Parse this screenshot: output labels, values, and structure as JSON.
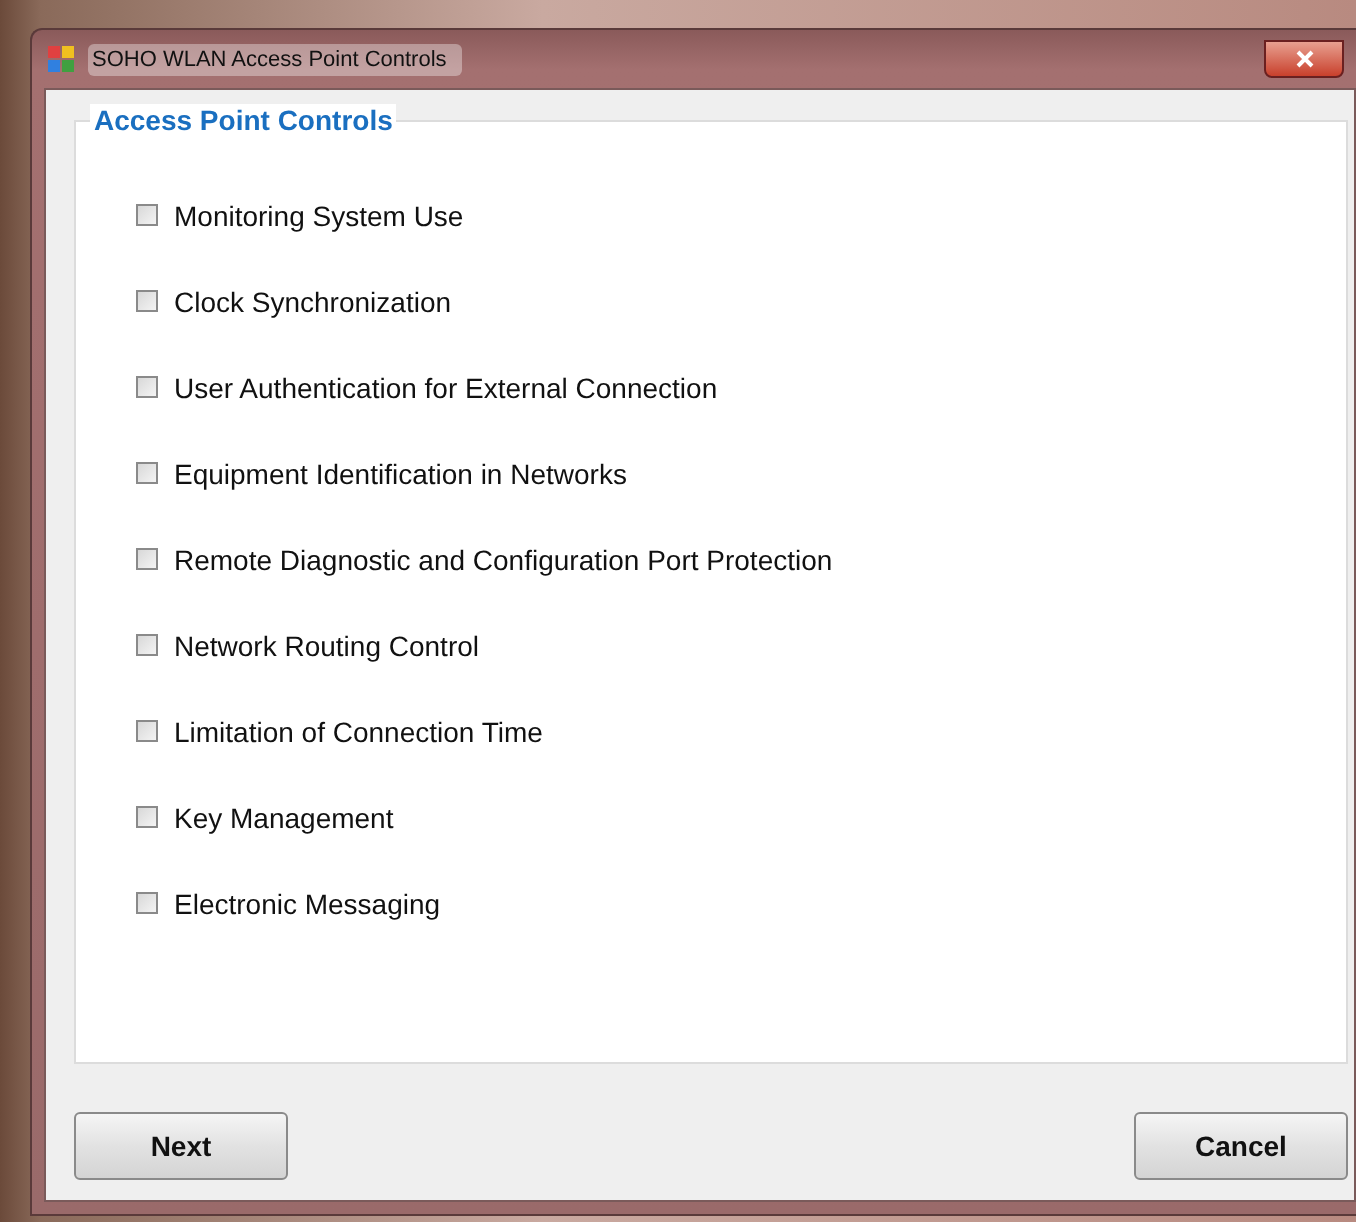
{
  "window": {
    "title": "SOHO WLAN Access Point Controls"
  },
  "group": {
    "title": "Access Point Controls"
  },
  "options": [
    {
      "label": "Monitoring System Use",
      "checked": false
    },
    {
      "label": "Clock Synchronization",
      "checked": false
    },
    {
      "label": "User Authentication for External Connection",
      "checked": false
    },
    {
      "label": "Equipment Identification in Networks",
      "checked": false
    },
    {
      "label": "Remote Diagnostic and Configuration Port Protection",
      "checked": false
    },
    {
      "label": "Network Routing Control",
      "checked": false
    },
    {
      "label": "Limitation of Connection Time",
      "checked": false
    },
    {
      "label": "Key Management",
      "checked": false
    },
    {
      "label": "Electronic Messaging",
      "checked": false
    }
  ],
  "buttons": [
    {
      "label": "Next"
    },
    {
      "label": "Cancel"
    }
  ]
}
